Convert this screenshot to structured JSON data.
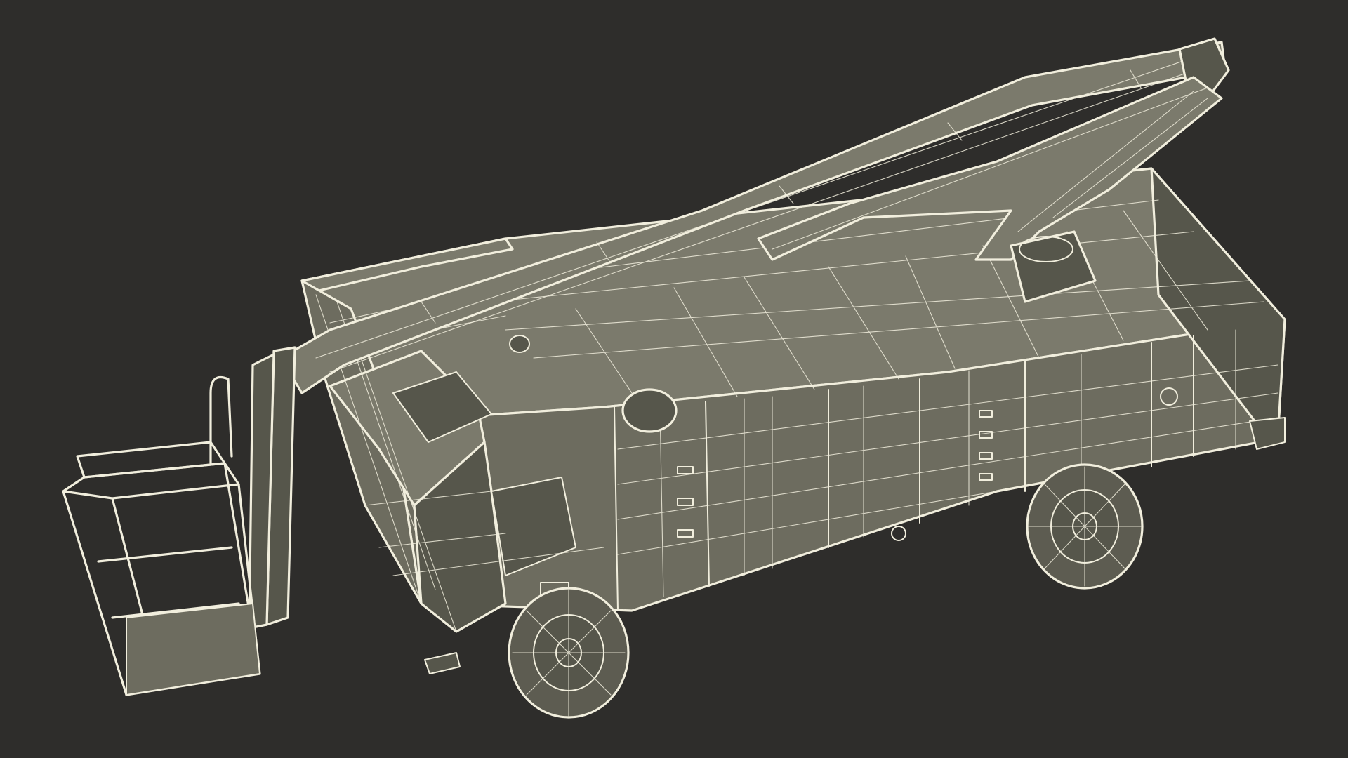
{
  "scene": {
    "background_color": "#2e2d2b",
    "wire_color": "#f1eedd",
    "surface_color": "#6d6c5f",
    "subject": "bucket-truck-wireframe"
  }
}
